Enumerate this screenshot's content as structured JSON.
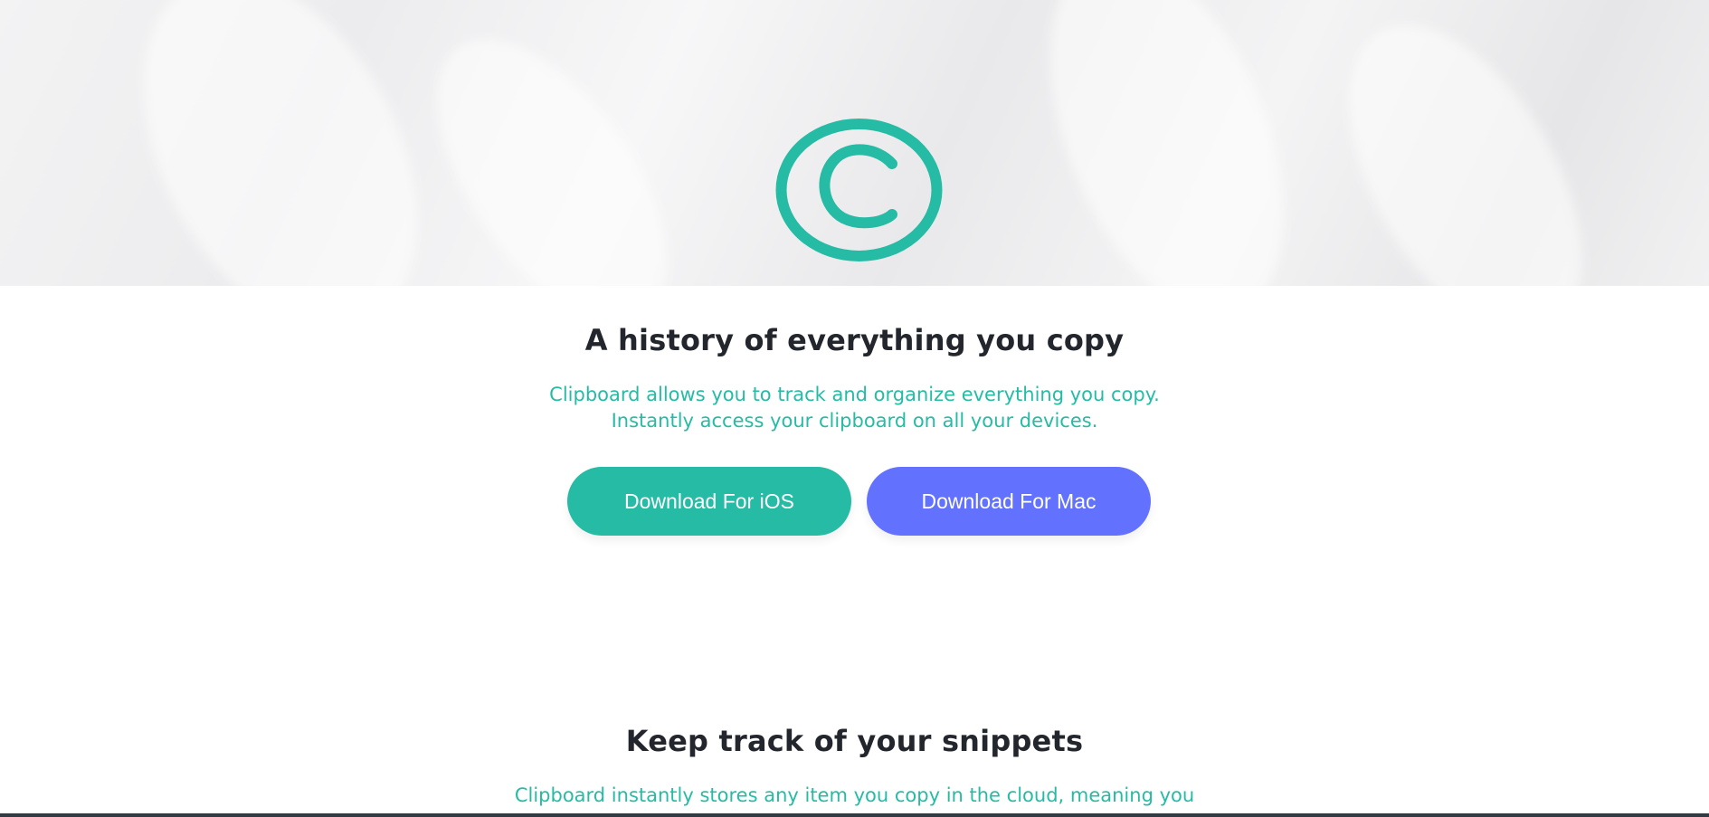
{
  "hero": {
    "logo_icon": "copyright-c-icon",
    "accent_color": "#26bba4"
  },
  "intro": {
    "title": "A history of everything you copy",
    "description_line1": "Clipboard allows you to track and organize everything you copy.",
    "description_line2": "Instantly access your clipboard on all your devices."
  },
  "buttons": {
    "ios_label": "Download For iOS",
    "ios_color": "#26bba4",
    "mac_label": "Download For Mac",
    "mac_color": "#6372fe"
  },
  "snippets": {
    "title": "Keep track of your snippets",
    "description_line1": "Clipboard instantly stores any item you copy in the cloud, meaning you"
  }
}
